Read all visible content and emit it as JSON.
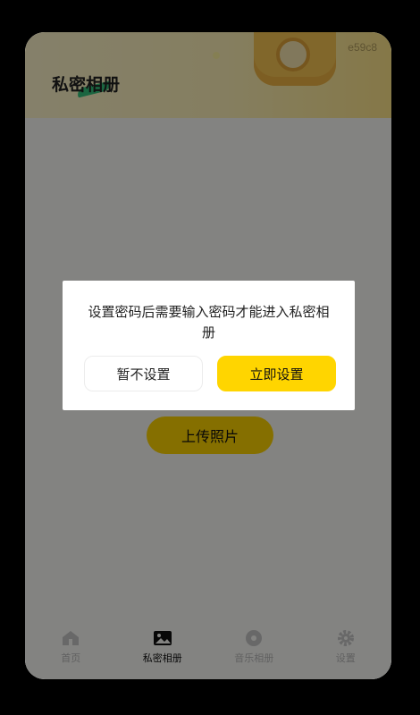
{
  "header": {
    "code": "e59c8",
    "title": "私密相册"
  },
  "main": {
    "upload_label": "上传照片"
  },
  "tabs": [
    {
      "label": "首页",
      "icon": "home-icon"
    },
    {
      "label": "私密相册",
      "icon": "photo-album-icon",
      "active": true
    },
    {
      "label": "音乐相册",
      "icon": "music-disc-icon"
    },
    {
      "label": "设置",
      "icon": "gear-icon"
    }
  ],
  "dialog": {
    "message": "设置密码后需要输入密码才能进入私密相册",
    "cancel_label": "暂不设置",
    "confirm_label": "立即设置"
  },
  "colors": {
    "accent": "#ffd500",
    "header_bg": "#fff2b8",
    "title_accent": "#34c27b"
  }
}
